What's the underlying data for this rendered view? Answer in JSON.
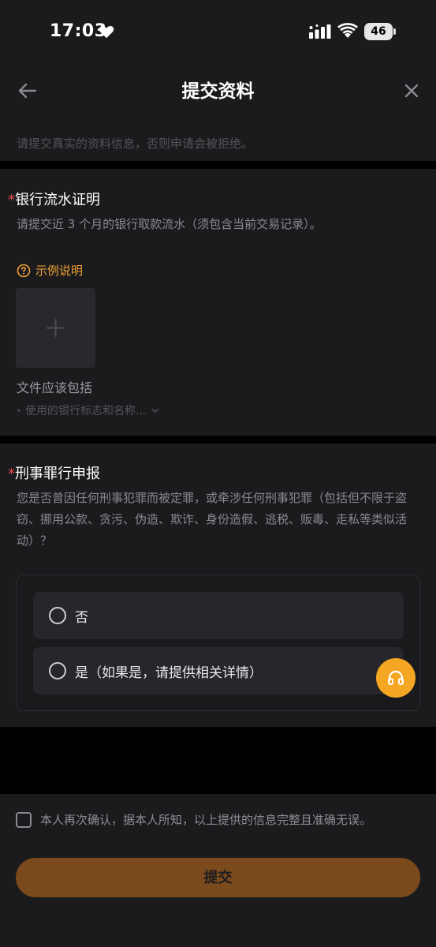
{
  "status_bar": {
    "time": "17:03",
    "battery": "46",
    "icons": [
      "heart-icon",
      "signal-icon",
      "wifi-icon",
      "battery-icon"
    ]
  },
  "header": {
    "title": "提交资料",
    "notice": "请提交真实的资料信息，否则申请会被拒绝。",
    "icons": [
      "back-arrow-icon",
      "close-icon"
    ]
  },
  "bank_section": {
    "required_mark": "*",
    "title": "银行流水证明",
    "description": "请提交近 3 个月的银行取款流水（须包含当前交易记录）。",
    "example_label": "示例说明",
    "file_label": "文件应该包括",
    "file_hint": "使用的银行标志和名称...",
    "icons": [
      "question-circle-icon",
      "plus-icon",
      "chevron-down-icon"
    ]
  },
  "criminal_section": {
    "required_mark": "*",
    "title": "刑事罪行申报",
    "description": "您是否曾因任何刑事犯罪而被定罪，或牵涉任何刑事犯罪（包括但不限于盗窃、挪用公款、贪污、伪造、欺诈、身份造假、逃税、贩毒、走私等类似活动）？",
    "options": [
      {
        "label": "否",
        "selected": false
      },
      {
        "label": "是（如果是，请提供相关详情）",
        "selected": false
      }
    ]
  },
  "support": {
    "icon": "headset-icon"
  },
  "footer": {
    "confirm_text": "本人再次确认，据本人所知，以上提供的信息完整且准确无误。",
    "confirm_checked": false,
    "submit_label": "提交"
  },
  "colors": {
    "background": "#1b1b1e",
    "accent": "#f0a032",
    "required": "#e34b4b",
    "submit_button": "#7b4a1c",
    "support_button": "#f5a623"
  }
}
